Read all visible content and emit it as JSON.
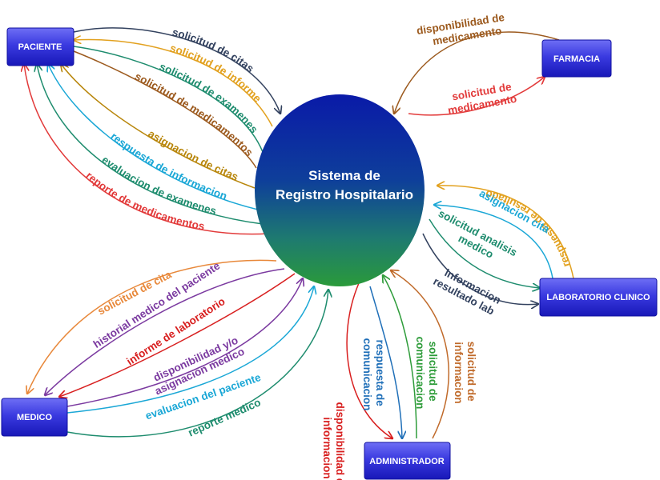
{
  "colors": {
    "navy": "#33425f",
    "gold": "#e2a11f",
    "teal": "#1e8c6e",
    "brown": "#9c5a1e",
    "ochre": "#b8860b",
    "cyan": "#1aa7d6",
    "red": "#e23a3a",
    "orange": "#e8883a",
    "purple": "#7b3aa0",
    "red_dark": "#d81f1f",
    "green": "#2e9c3a",
    "blue": "#1f6fb8"
  },
  "system": {
    "line1": "Sistema de",
    "line2": "Registro Hospitalario"
  },
  "entities": {
    "paciente": "PACIENTE",
    "farmacia": "FARMACIA",
    "laboratorio": "LABORATORIO CLINICO",
    "medico": "MEDICO",
    "administrador": "ADMINISTRADOR"
  },
  "flows": {
    "p1": "solicitud de citas",
    "p2": "solicitud de informe",
    "p3": "solicitud de examenes",
    "p4": "solicitud de medicamentos",
    "p5": "asignacion de citas",
    "p6": "respuesta de informacion",
    "p7": "evaluacion de examenes",
    "p8": "reporte de medicamentos",
    "f1": "disponibilidad de",
    "f1b": "medicamento",
    "f2": "solicitud de",
    "f2b": "medicamento",
    "l1": "respuesta de resultado",
    "l2": "asignacion cita",
    "l3": "solicitud analisis",
    "l3b": "medico",
    "l4": "informacion",
    "l4b": "resultado lab",
    "m1": "solicitud de cita",
    "m2": "historial medico del paciente",
    "m3": "informe de laboratorio",
    "m4": "disponibilidad y/o",
    "m4b": "asignacion medico",
    "m5": "evaluacion del paciente",
    "m6": "reporte medico",
    "a1": "disponibilidad de",
    "a1b": "informacion",
    "a2": "respuesta de",
    "a2b": "comunicacion",
    "a3": "solicitud de",
    "a3b": "comunicacion",
    "a4": "solicitud de",
    "a4b": "informacion"
  }
}
